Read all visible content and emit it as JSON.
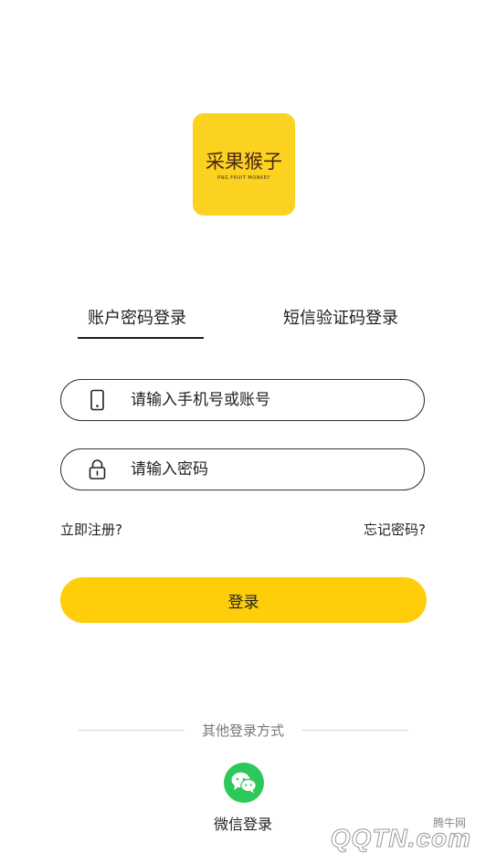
{
  "logo": {
    "brand_text": "采果猴子",
    "subtext": "PNG FRUIT MONKEY",
    "bg_color": "#FCD221"
  },
  "tabs": {
    "account_login": "账户密码登录",
    "sms_login": "短信验证码登录",
    "active": "account_login"
  },
  "form": {
    "phone_placeholder": "请输入手机号或账号",
    "phone_value": "",
    "password_placeholder": "请输入密码",
    "password_value": ""
  },
  "links": {
    "register": "立即注册?",
    "forgot_password": "忘记密码?"
  },
  "login_button": {
    "label": "登录",
    "color": "#FFCD0A"
  },
  "other_login": {
    "divider_text": "其他登录方式",
    "wechat_label": "微信登录",
    "wechat_color": "#2DC85A"
  },
  "watermark": {
    "cn": "腾牛网",
    "en": "QQTN.com"
  }
}
